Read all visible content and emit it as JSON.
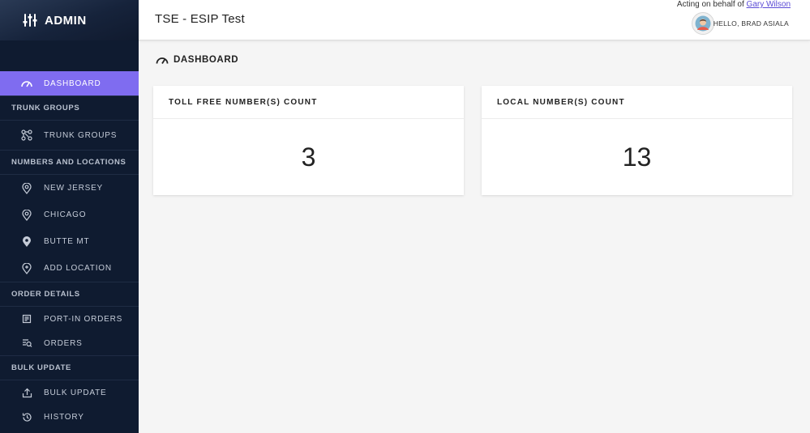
{
  "brand": {
    "title": "ADMIN",
    "icon": "sliders-icon"
  },
  "header": {
    "page_title": "TSE - ESIP Test",
    "acting_prefix": "Acting on behalf of",
    "acting_user": "Gary Wilson",
    "greeting": "HELLO, BRAD ASIALA"
  },
  "sidebar": {
    "dashboard": "DASHBOARD",
    "sections": {
      "trunk_groups": "TRUNK GROUPS",
      "numbers_locations": "NUMBERS AND LOCATIONS",
      "order_details": "ORDER DETAILS",
      "bulk_update": "BULK UPDATE"
    },
    "items": {
      "trunk_groups": "TRUNK GROUPS",
      "new_jersey": "NEW JERSEY",
      "chicago": "CHICAGO",
      "butte_mt": "BUTTE MT",
      "add_location": "ADD LOCATION",
      "port_in_orders": "PORT-IN ORDERS",
      "orders": "ORDERS",
      "bulk_update": "BULK UPDATE",
      "history": "HISTORY"
    }
  },
  "main": {
    "section_title": "DASHBOARD",
    "cards": [
      {
        "title": "TOLL FREE NUMBER(S) COUNT",
        "value": "3"
      },
      {
        "title": "LOCAL NUMBER(S) COUNT",
        "value": "13"
      }
    ]
  },
  "colors": {
    "sidebar": "#0f1b30",
    "accent": "#7f6cf0",
    "link": "#5b4bd6"
  }
}
